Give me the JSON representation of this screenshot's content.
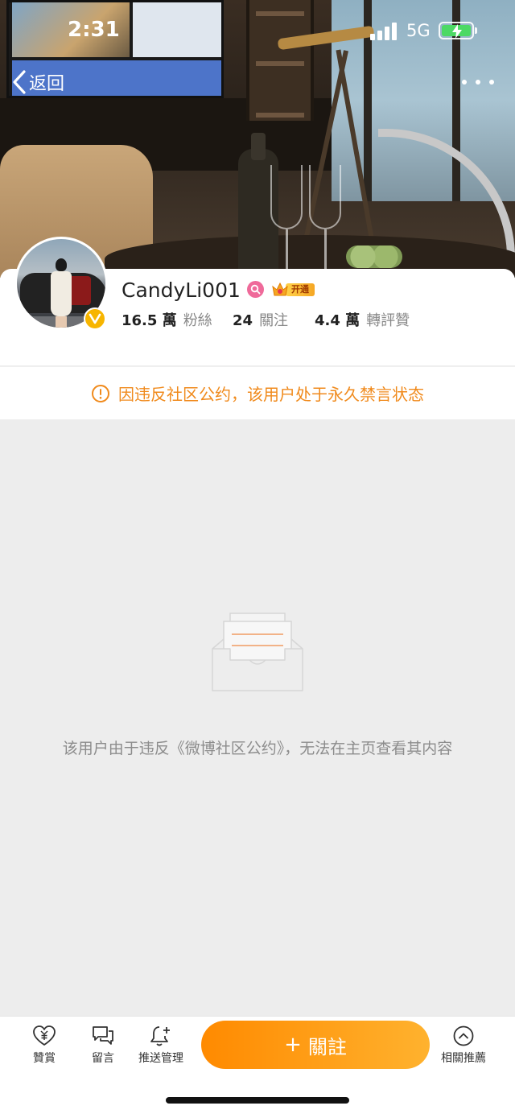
{
  "status_bar": {
    "time": "2:31",
    "network": "5G",
    "battery_charging": true,
    "icons": [
      "signal-icon",
      "battery-icon"
    ]
  },
  "nav": {
    "back_label": "返回",
    "back_icon": "chevron-left-icon",
    "more_icon": "more-icon"
  },
  "profile": {
    "username": "CandyLi001",
    "vip_label": "开通",
    "badges": [
      "verified-icon",
      "search-badge-icon",
      "vip-crown-icon"
    ],
    "stats": {
      "followers": {
        "value": "16.5 萬",
        "label": "粉絲"
      },
      "following": {
        "value": "24",
        "label": "關注"
      },
      "engagement": {
        "value": "4.4 萬",
        "label": "轉評贊"
      }
    }
  },
  "ban_notice": {
    "icon": "warning-icon",
    "text": "因违反社区公约，该用户处于永久禁言状态"
  },
  "empty_state": {
    "icon": "empty-box-icon",
    "message": "该用户由于违反《微博社区公约》，无法在主页查看其内容"
  },
  "bottom_bar": {
    "reward": {
      "label": "贊賞",
      "icon": "heart-yen-icon"
    },
    "message": {
      "label": "留言",
      "icon": "chat-bubble-icon"
    },
    "push": {
      "label": "推送管理",
      "icon": "bell-plus-icon"
    },
    "follow": {
      "label": "關註",
      "icon": "plus-icon"
    },
    "related": {
      "label": "相關推薦",
      "icon": "chevron-up-circle-icon"
    }
  },
  "colors": {
    "accent": "#f08a1c",
    "follow_start": "#ff8a00",
    "follow_end": "#ffb22e",
    "verified": "#f7b500",
    "page_bg": "#ededed"
  }
}
